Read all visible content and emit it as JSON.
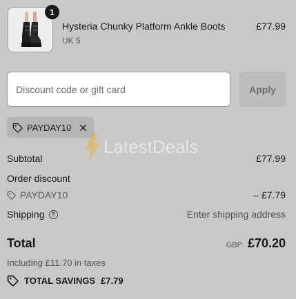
{
  "product": {
    "quantity": "1",
    "name": "Hysteria Chunky Platform Ankle Boots",
    "variant": "UK 5",
    "price": "£77.99",
    "image_icon": "boot-image"
  },
  "discount": {
    "placeholder": "Discount code or gift card",
    "value": "",
    "apply_label": "Apply",
    "applied_code": "PAYDAY10"
  },
  "watermark": {
    "text": "LatestDeals"
  },
  "summary": {
    "subtotal_label": "Subtotal",
    "subtotal_value": "£77.99",
    "order_discount_label": "Order discount",
    "discount_code": "PAYDAY10",
    "discount_value": "– £7.79",
    "shipping_label": "Shipping",
    "shipping_value": "Enter shipping address",
    "total_label": "Total",
    "currency": "GBP",
    "total_value": "£70.20",
    "tax_note": "Including £11.70 in taxes",
    "savings_label": "TOTAL SAVINGS",
    "savings_value": "£7.79"
  },
  "colors": {
    "background": "#c8c8c8",
    "text": "#1a1a1a",
    "muted": "#555555",
    "chip": "#b5b5b5",
    "watermark": "#e9b13b"
  }
}
